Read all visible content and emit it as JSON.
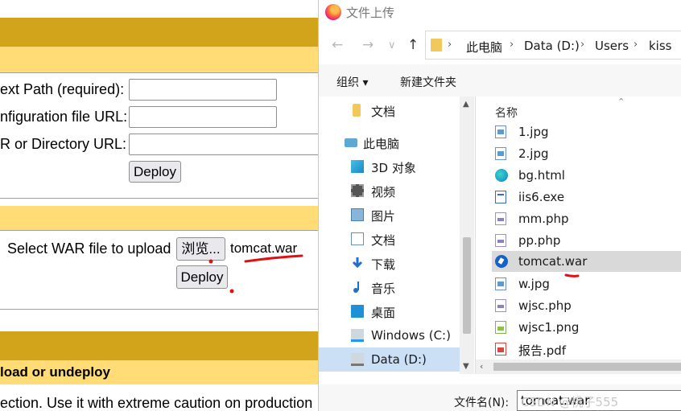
{
  "manager": {
    "context_path_label": "ext Path (required):",
    "config_url_label": "nfiguration file URL:",
    "war_dir_url_label": "R or Directory URL:",
    "deploy_label_1": "Deploy",
    "select_war_label": "Select WAR file to upload",
    "browse_label": "浏览...",
    "chosen_file": "tomcat.war",
    "deploy_label_2": "Deploy",
    "section_title": "load or undeploy",
    "caution_text": "ection. Use it with extreme caution on production"
  },
  "dialog": {
    "title": "文件上传",
    "nav": {
      "back": "←",
      "forward": "→",
      "down": "∨",
      "up": "↑"
    },
    "breadcrumbs": [
      "此电脑",
      "Data (D:)",
      "Users",
      "kiss"
    ],
    "commands": {
      "organize": "组织 ▾",
      "new_folder": "新建文件夹"
    },
    "nav_items": [
      {
        "label": "文档",
        "icon": "folder-icon"
      },
      {
        "label": "此电脑",
        "icon": "computer-icon"
      },
      {
        "label": "3D 对象",
        "icon": "3d-objects-icon"
      },
      {
        "label": "视频",
        "icon": "video-icon"
      },
      {
        "label": "图片",
        "icon": "pictures-icon"
      },
      {
        "label": "文档",
        "icon": "documents-icon"
      },
      {
        "label": "下载",
        "icon": "download-icon"
      },
      {
        "label": "音乐",
        "icon": "music-icon"
      },
      {
        "label": "桌面",
        "icon": "desktop-icon"
      },
      {
        "label": "Windows (C:)",
        "icon": "drive-icon"
      },
      {
        "label": "Data (D:)",
        "icon": "drive-icon"
      }
    ],
    "column_header": "名称",
    "files": [
      {
        "name": "1.jpg",
        "icon": "image-file-icon"
      },
      {
        "name": "2.jpg",
        "icon": "image-file-icon"
      },
      {
        "name": "bg.html",
        "icon": "edge-file-icon"
      },
      {
        "name": "iis6.exe",
        "icon": "exe-file-icon"
      },
      {
        "name": "mm.php",
        "icon": "php-file-icon"
      },
      {
        "name": "pp.php",
        "icon": "php-file-icon"
      },
      {
        "name": "tomcat.war",
        "icon": "war-file-icon"
      },
      {
        "name": "w.jpg",
        "icon": "image-file-icon"
      },
      {
        "name": "wjsc.php",
        "icon": "php-file-icon"
      },
      {
        "name": "wjsc1.png",
        "icon": "png-file-icon"
      },
      {
        "name": "报告.pdf",
        "icon": "pdf-file-icon"
      }
    ],
    "filename_label": "文件名(N):",
    "filename_value": "tomcat.war",
    "watermark": "CSDN @桃子555"
  },
  "colors": {
    "section_gold": "#d2a41c",
    "section_pale": "#ffdc75",
    "annotation_red": "#e01010",
    "selection_blue": "#cce0f5"
  }
}
